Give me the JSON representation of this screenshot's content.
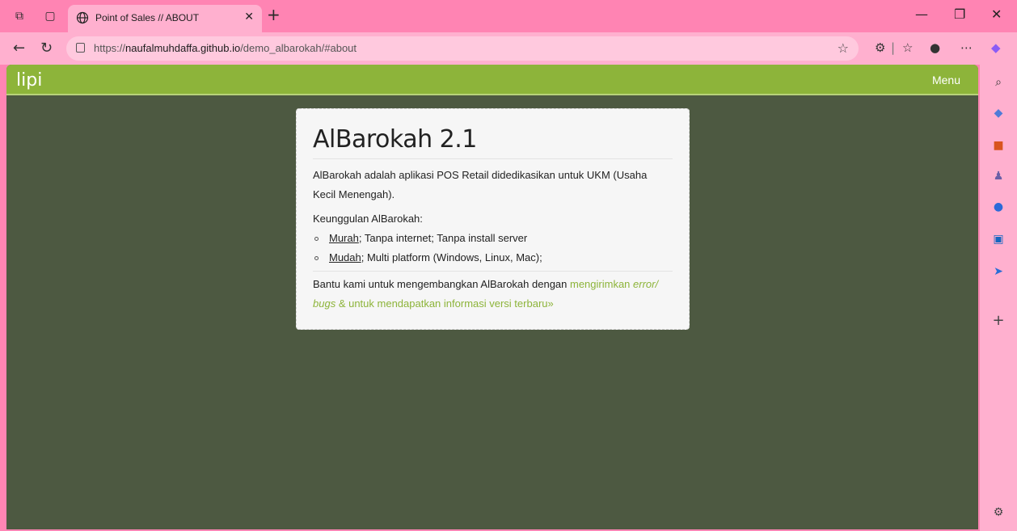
{
  "browser": {
    "tab_title": "Point of Sales // ABOUT",
    "url_prefix": "https://",
    "url_host": "naufalmuhdaffa.github.io",
    "url_path": "/demo_albarokah/#about"
  },
  "navbar": {
    "brand": "lipi",
    "menu": "Menu"
  },
  "card": {
    "title": "AlBarokah 2.1",
    "intro": "AlBarokah adalah aplikasi POS Retail didedikasikan untuk UKM (Usaha Kecil Menengah).",
    "advantages_title": "Keunggulan AlBarokah:",
    "advantages": [
      {
        "key": "Murah",
        "rest": "; Tanpa internet; Tanpa install server"
      },
      {
        "key": "Mudah",
        "rest": "; Multi platform (Windows, Linux, Mac);"
      }
    ],
    "footer_text": "Bantu kami untuk mengembangkan AlBarokah dengan ",
    "footer_link_1": "mengirimkan ",
    "footer_link_italic": "error/ bugs",
    "footer_link_2": " & untuk mendapatkan informasi versi terbaru»"
  },
  "colors": {
    "accent": "#8db43a",
    "page_bg": "#4d5941",
    "chrome": "#ff84b3"
  }
}
